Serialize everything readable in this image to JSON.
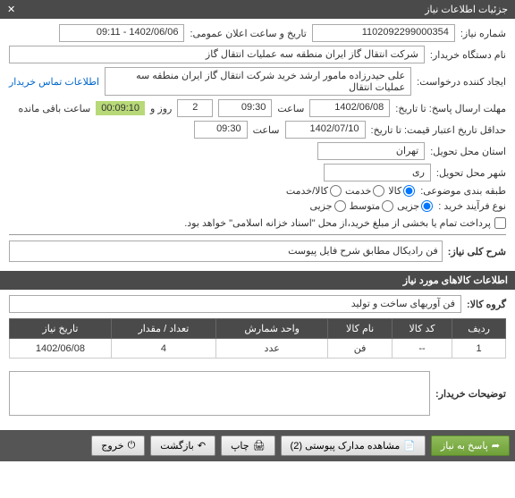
{
  "header": {
    "title": "جزئیات اطلاعات نیاز"
  },
  "fields": {
    "niaz_no_label": "شماره نیاز:",
    "niaz_no": "1102092299000354",
    "public_date_label": "تاریخ و ساعت اعلان عمومی:",
    "public_date": "1402/06/06 - 09:11",
    "buyer_label": "نام دستگاه خریدار:",
    "buyer": "شرکت انتقال گاز ایران منطقه سه عملیات انتقال گاز",
    "creator_label": "ایجاد کننده درخواست:",
    "creator": "علی حیدرزاده مامور ارشد خرید شرکت انتقال گاز ایران منطقه سه عملیات انتقال",
    "contact_link": "اطلاعات تماس خریدار",
    "deadline_label": "مهلت ارسال پاسخ: تا تاریخ:",
    "deadline_date": "1402/06/08",
    "time_label": "ساعت",
    "deadline_time": "09:30",
    "day_label": "روز و",
    "days": "2",
    "countdown": "00:09:10",
    "remaining_label": "ساعت باقی مانده",
    "validity_label": "حداقل تاریخ اعتبار قیمت: تا تاریخ:",
    "validity_date": "1402/07/10",
    "validity_time": "09:30",
    "province_label": "استان محل تحویل:",
    "province": "تهران",
    "city_label": "شهر محل تحویل:",
    "city": "ری",
    "category_label": "طبقه بندی موضوعی:",
    "cat_kala": "کالا",
    "cat_khedmat": "خدمت",
    "cat_both": "کالا/خدمت",
    "process_label": "نوع فرآیند خرید :",
    "proc_jozei": "جزیی",
    "proc_motevaset": "متوسط",
    "proc_omde": "جزیی",
    "payment_label": "پرداخت تمام یا بخشی از مبلغ خرید،از محل \"اسناد خزانه اسلامی\" خواهد بود.",
    "desc_label": "شرح کلی نیاز:",
    "desc": "فن رادیکال مطابق شرح فایل پیوست",
    "items_header": "اطلاعات کالاهای مورد نیاز",
    "group_label": "گروه کالا:",
    "group": "فن آوریهای ساخت و تولید",
    "notes_label": "توضیحات خریدار:"
  },
  "radios": {
    "cat": "kala",
    "proc": "jozei"
  },
  "table": {
    "headers": [
      "ردیف",
      "کد کالا",
      "نام کالا",
      "واحد شمارش",
      "تعداد / مقدار",
      "تاریخ نیاز"
    ],
    "rows": [
      {
        "idx": "1",
        "code": "--",
        "name": "فن",
        "unit": "عدد",
        "qty": "4",
        "date": "1402/06/08"
      }
    ]
  },
  "footer": {
    "respond": "پاسخ به نیاز",
    "attachments": "مشاهده مدارک پیوستی (2)",
    "print": "چاپ",
    "back": "بازگشت",
    "exit": "خروج"
  }
}
